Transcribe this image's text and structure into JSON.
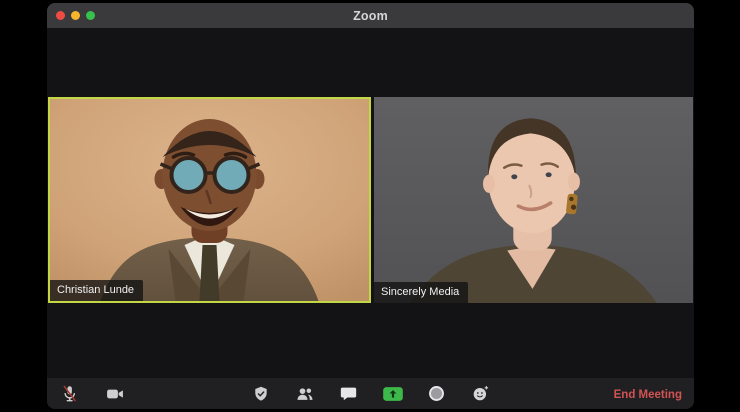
{
  "window": {
    "title": "Zoom"
  },
  "participants": [
    {
      "name": "Christian Lunde",
      "active_speaker": true
    },
    {
      "name": "Sincerely Media",
      "active_speaker": false
    }
  ],
  "toolbar": {
    "icons": [
      {
        "name": "microphone-muted-icon",
        "muted": true
      },
      {
        "name": "video-camera-icon"
      },
      {
        "name": "security-shield-icon"
      },
      {
        "name": "participants-icon"
      },
      {
        "name": "chat-bubble-icon"
      },
      {
        "name": "share-screen-icon"
      },
      {
        "name": "record-icon"
      },
      {
        "name": "reactions-smiley-icon"
      }
    ],
    "end_meeting_label": "End Meeting"
  },
  "colors": {
    "active_speaker_border": "#c3d644",
    "share_button_green": "#3db84a",
    "end_meeting_red": "#d25353",
    "titlebar_bg": "#3a3a3c",
    "toolbar_bg": "#202022",
    "content_bg": "#131315",
    "traffic_close": "#ee4b44",
    "traffic_minimize": "#f5b52d",
    "traffic_zoom": "#36c24d",
    "mute_slash_red": "#a93b30"
  }
}
